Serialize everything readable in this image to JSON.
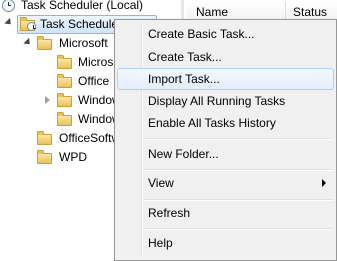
{
  "tree": {
    "root_label": "Task Scheduler (Local)",
    "library_label": "Task Scheduler Library",
    "items": [
      {
        "label": "Microsoft"
      },
      {
        "label": "Microsoft"
      },
      {
        "label": "Office"
      },
      {
        "label": "Windows"
      },
      {
        "label": "Windows"
      },
      {
        "label": "OfficeSoftwareProtectionPlatform"
      },
      {
        "label": "WPD"
      }
    ]
  },
  "list": {
    "columns": [
      {
        "label": "Name"
      },
      {
        "label": "Status"
      }
    ]
  },
  "context_menu": {
    "items": [
      {
        "label": "Create Basic Task..."
      },
      {
        "label": "Create Task..."
      },
      {
        "label": "Import Task..."
      },
      {
        "label": "Display All Running Tasks"
      },
      {
        "label": "Enable All Tasks History"
      },
      {
        "label": "New Folder..."
      },
      {
        "label": "View"
      },
      {
        "label": "Refresh"
      },
      {
        "label": "Help"
      }
    ],
    "highlighted_item": "Import Task..."
  },
  "colors": {
    "menu_background": "#f0f0f0",
    "highlight_border": "#aecff7",
    "folder": "#e9c35a"
  },
  "icons": {
    "root": "clock-icon",
    "library": "clock-folder-icon",
    "folders": "folder-icon",
    "submenu": "chevron-right-icon"
  }
}
